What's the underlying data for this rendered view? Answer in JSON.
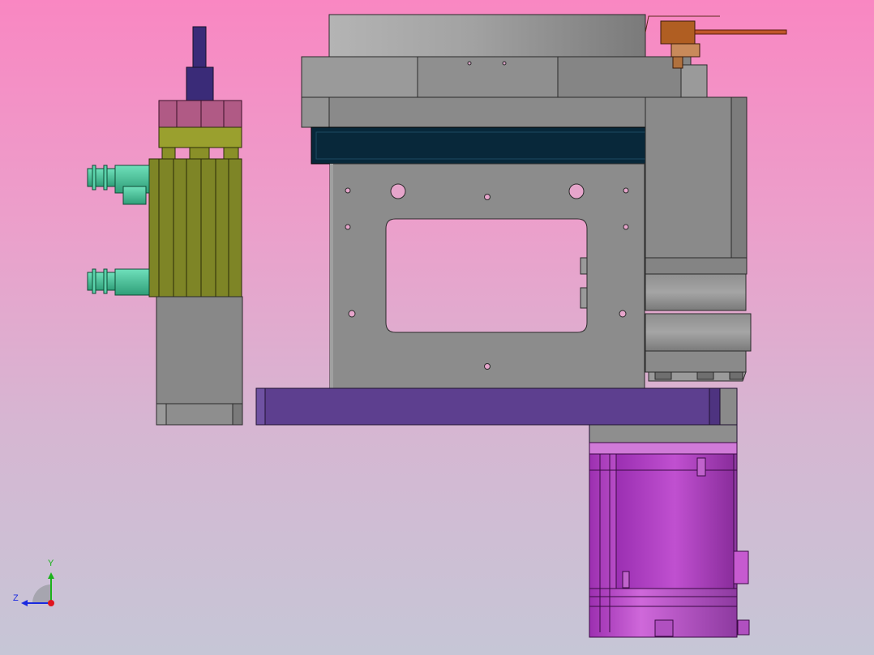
{
  "triad": {
    "y_label": "Y",
    "z_label": "Z",
    "y_color": "#1bb21b",
    "z_color": "#1a2ae0",
    "x_color": "#e0141e"
  },
  "parts": [
    {
      "name": "rotary-disc",
      "color": "#a9a9a9"
    },
    {
      "name": "top-frame",
      "color": "#8f8f8f"
    },
    {
      "name": "dark-plate",
      "color": "#08283a"
    },
    {
      "name": "main-plate",
      "color": "#8c8c8c"
    },
    {
      "name": "side-housing",
      "color": "#8a8a8a"
    },
    {
      "name": "base-bar",
      "color": "#5d3f8f"
    },
    {
      "name": "servo-motor",
      "color": "#c456cf"
    },
    {
      "name": "cylinder-body",
      "color": "#7e8526"
    },
    {
      "name": "cylinder-cap",
      "color": "#b05a85"
    },
    {
      "name": "cylinder-rod",
      "color": "#3a2b78"
    },
    {
      "name": "air-fitting",
      "color": "#4ccaa0"
    },
    {
      "name": "cylinder-mount",
      "color": "#888888"
    },
    {
      "name": "cable-sensor",
      "color": "#b05e22"
    }
  ]
}
